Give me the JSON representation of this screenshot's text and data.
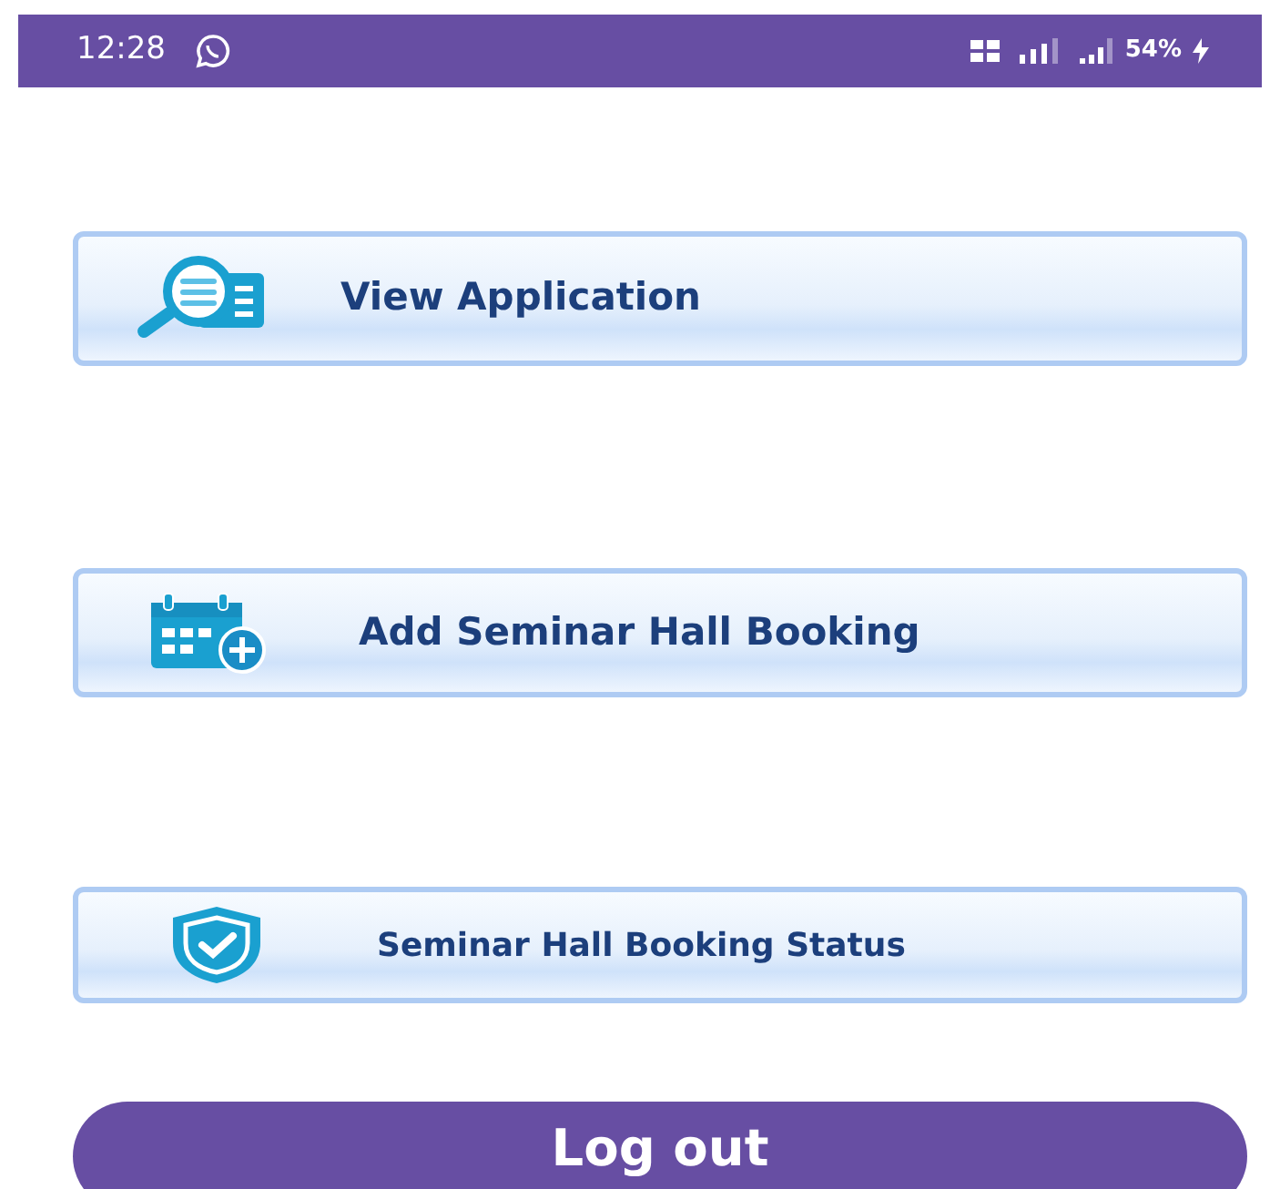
{
  "status_bar": {
    "time": "12:28",
    "battery": "54%"
  },
  "menu_buttons": [
    {
      "label": "View Application",
      "kind": "view"
    },
    {
      "label": "Add Seminar Hall Booking",
      "kind": "add"
    },
    {
      "label": "Seminar Hall Booking Status",
      "kind": "status"
    }
  ],
  "logout_button": {
    "label": "Log out"
  }
}
